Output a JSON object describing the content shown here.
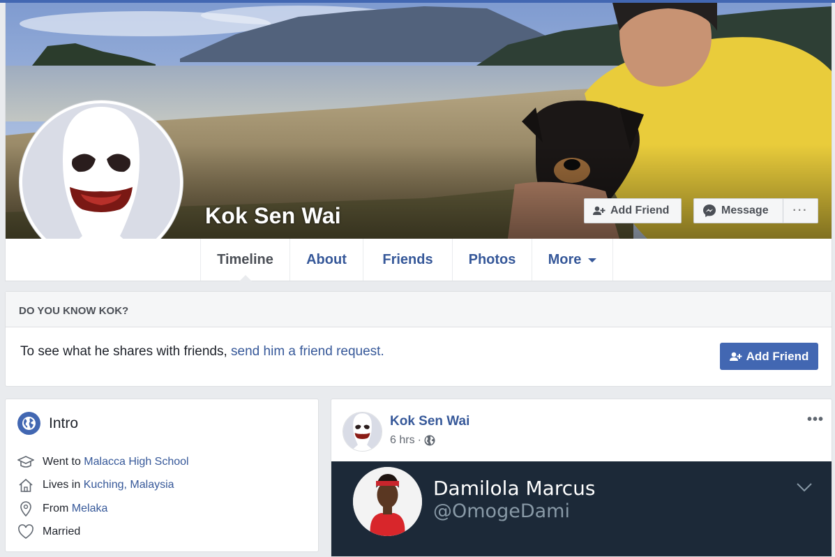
{
  "profile": {
    "name": "Kok Sen Wai"
  },
  "cover_actions": {
    "add_friend_label": "Add Friend",
    "message_label": "Message",
    "more_label": "···"
  },
  "tabs": [
    {
      "label": "Timeline",
      "active": true
    },
    {
      "label": "About",
      "active": false
    },
    {
      "label": "Friends",
      "active": false
    },
    {
      "label": "Photos",
      "active": false
    },
    {
      "label": "More",
      "active": false
    }
  ],
  "know_panel": {
    "heading": "DO YOU KNOW KOK?",
    "text_prefix": "To see what he shares with friends, ",
    "link_text": "send him a friend request.",
    "button_label": "Add Friend"
  },
  "intro": {
    "title": "Intro",
    "items": [
      {
        "icon": "graduation-cap-icon",
        "prefix": "Went to ",
        "link": "Malacca High School"
      },
      {
        "icon": "home-icon",
        "prefix": "Lives in ",
        "link": "Kuching, Malaysia"
      },
      {
        "icon": "location-pin-icon",
        "prefix": "From ",
        "link": "Melaka"
      },
      {
        "icon": "heart-icon",
        "prefix": "Married",
        "link": ""
      }
    ]
  },
  "post": {
    "author": "Kok Sen Wai",
    "time": "6 hrs",
    "separator": "·",
    "more": "•••",
    "embedded_tweet": {
      "name": "Damilola Marcus",
      "handle": "@OmogeDami"
    }
  },
  "colors": {
    "brand_blue": "#4267b2",
    "link_blue": "#365899",
    "page_bg": "#e9ebee",
    "tweet_bg": "#1c2938"
  }
}
